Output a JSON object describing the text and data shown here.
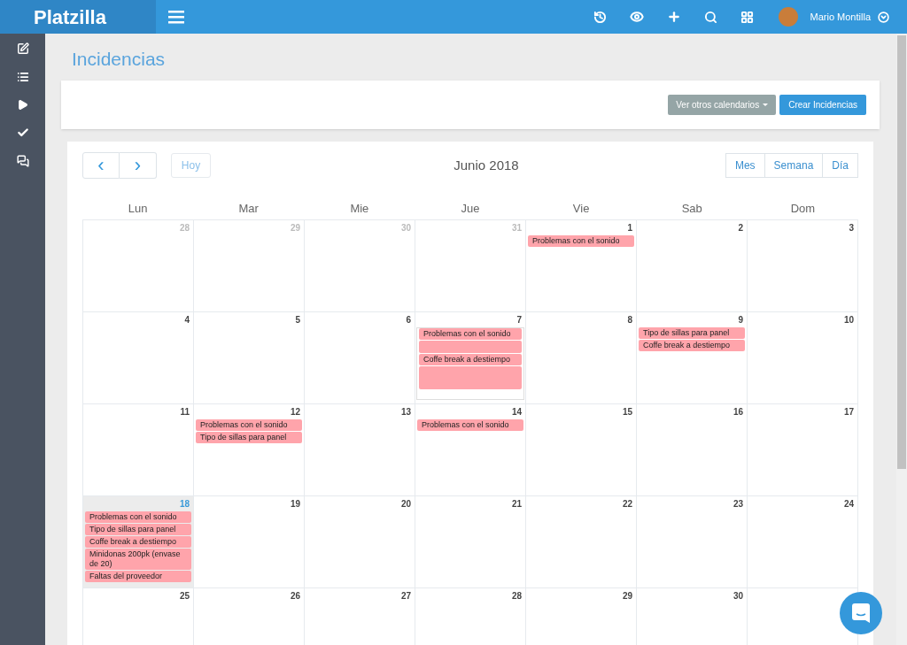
{
  "app": {
    "logo": "Platzilla",
    "user_name": "Mario Montilla"
  },
  "page_title": "Incidencias",
  "toolbar": {
    "other_calendars": "Ver otros calendarios",
    "create": "Crear Incidencias"
  },
  "calendar": {
    "prev": "‹",
    "next": "›",
    "today_button": "Hoy",
    "title": "Junio 2018",
    "views": [
      {
        "label": "Mes",
        "selected": false
      },
      {
        "label": "Semana",
        "selected": false
      },
      {
        "label": "Día",
        "selected": false
      }
    ],
    "weekdays": [
      "Lun",
      "Mar",
      "Mie",
      "Jue",
      "Vie",
      "Sab",
      "Dom"
    ],
    "weeks": [
      {
        "days": [
          {
            "date": "28",
            "other_month": true,
            "today": false,
            "outlined": false
          },
          {
            "date": "29",
            "other_month": true,
            "today": false,
            "outlined": false
          },
          {
            "date": "30",
            "other_month": true,
            "today": false,
            "outlined": false
          },
          {
            "date": "31",
            "other_month": true,
            "today": false,
            "outlined": false
          },
          {
            "date": "1",
            "other_month": false,
            "today": false,
            "outlined": false,
            "events": [
              {
                "kind": "titled",
                "title": "Problemas con el sonido"
              }
            ]
          },
          {
            "date": "2",
            "other_month": false,
            "today": false,
            "outlined": false
          },
          {
            "date": "3",
            "other_month": false,
            "today": false,
            "outlined": false
          }
        ]
      },
      {
        "days": [
          {
            "date": "4",
            "other_month": false,
            "today": false,
            "outlined": false
          },
          {
            "date": "5",
            "other_month": false,
            "today": false,
            "outlined": false
          },
          {
            "date": "6",
            "other_month": false,
            "today": false,
            "outlined": false
          },
          {
            "date": "7",
            "other_month": false,
            "today": false,
            "outlined": true,
            "events": [
              {
                "kind": "titled",
                "title": "Problemas con el sonido"
              },
              {
                "kind": "blank"
              },
              {
                "kind": "titled",
                "title": "Coffe break a destiempo"
              },
              {
                "kind": "blank_tall"
              }
            ]
          },
          {
            "date": "8",
            "other_month": false,
            "today": false,
            "outlined": false
          },
          {
            "date": "9",
            "other_month": false,
            "today": false,
            "outlined": false,
            "events": [
              {
                "kind": "titled",
                "title": "Tipo de sillas para panel"
              },
              {
                "kind": "titled",
                "title": "Coffe break a destiempo"
              }
            ]
          },
          {
            "date": "10",
            "other_month": false,
            "today": false,
            "outlined": false
          }
        ]
      },
      {
        "days": [
          {
            "date": "11",
            "other_month": false,
            "today": false,
            "outlined": false
          },
          {
            "date": "12",
            "other_month": false,
            "today": false,
            "outlined": false,
            "events": [
              {
                "kind": "titled",
                "title": "Problemas con el sonido"
              },
              {
                "kind": "titled",
                "title": "Tipo de sillas para panel"
              }
            ]
          },
          {
            "date": "13",
            "other_month": false,
            "today": false,
            "outlined": false
          },
          {
            "date": "14",
            "other_month": false,
            "today": false,
            "outlined": false,
            "events": [
              {
                "kind": "titled",
                "title": "Problemas con el sonido"
              }
            ]
          },
          {
            "date": "15",
            "other_month": false,
            "today": false,
            "outlined": false
          },
          {
            "date": "16",
            "other_month": false,
            "today": false,
            "outlined": false
          },
          {
            "date": "17",
            "other_month": false,
            "today": false,
            "outlined": false
          }
        ]
      },
      {
        "days": [
          {
            "date": "18",
            "other_month": false,
            "today": true,
            "outlined": false,
            "events": [
              {
                "kind": "titled",
                "title": "Problemas con el sonido"
              },
              {
                "kind": "titled",
                "title": "Tipo de sillas para panel"
              },
              {
                "kind": "titled",
                "title": "Coffe break a destiempo"
              },
              {
                "kind": "titled",
                "title": "Minidonas 200pk (envase de 20)"
              },
              {
                "kind": "titled",
                "title": "Faltas del proveedor"
              }
            ]
          },
          {
            "date": "19",
            "other_month": false,
            "today": false,
            "outlined": false
          },
          {
            "date": "20",
            "other_month": false,
            "today": false,
            "outlined": false
          },
          {
            "date": "21",
            "other_month": false,
            "today": false,
            "outlined": false
          },
          {
            "date": "22",
            "other_month": false,
            "today": false,
            "outlined": false
          },
          {
            "date": "23",
            "other_month": false,
            "today": false,
            "outlined": false
          },
          {
            "date": "24",
            "other_month": false,
            "today": false,
            "outlined": false
          }
        ]
      },
      {
        "days": [
          {
            "date": "25",
            "other_month": false,
            "today": false,
            "outlined": false
          },
          {
            "date": "26",
            "other_month": false,
            "today": false,
            "outlined": false
          },
          {
            "date": "27",
            "other_month": false,
            "today": false,
            "outlined": false
          },
          {
            "date": "28",
            "other_month": false,
            "today": false,
            "outlined": false
          },
          {
            "date": "29",
            "other_month": false,
            "today": false,
            "outlined": false
          },
          {
            "date": "30",
            "other_month": false,
            "today": false,
            "outlined": false
          }
        ]
      }
    ]
  }
}
